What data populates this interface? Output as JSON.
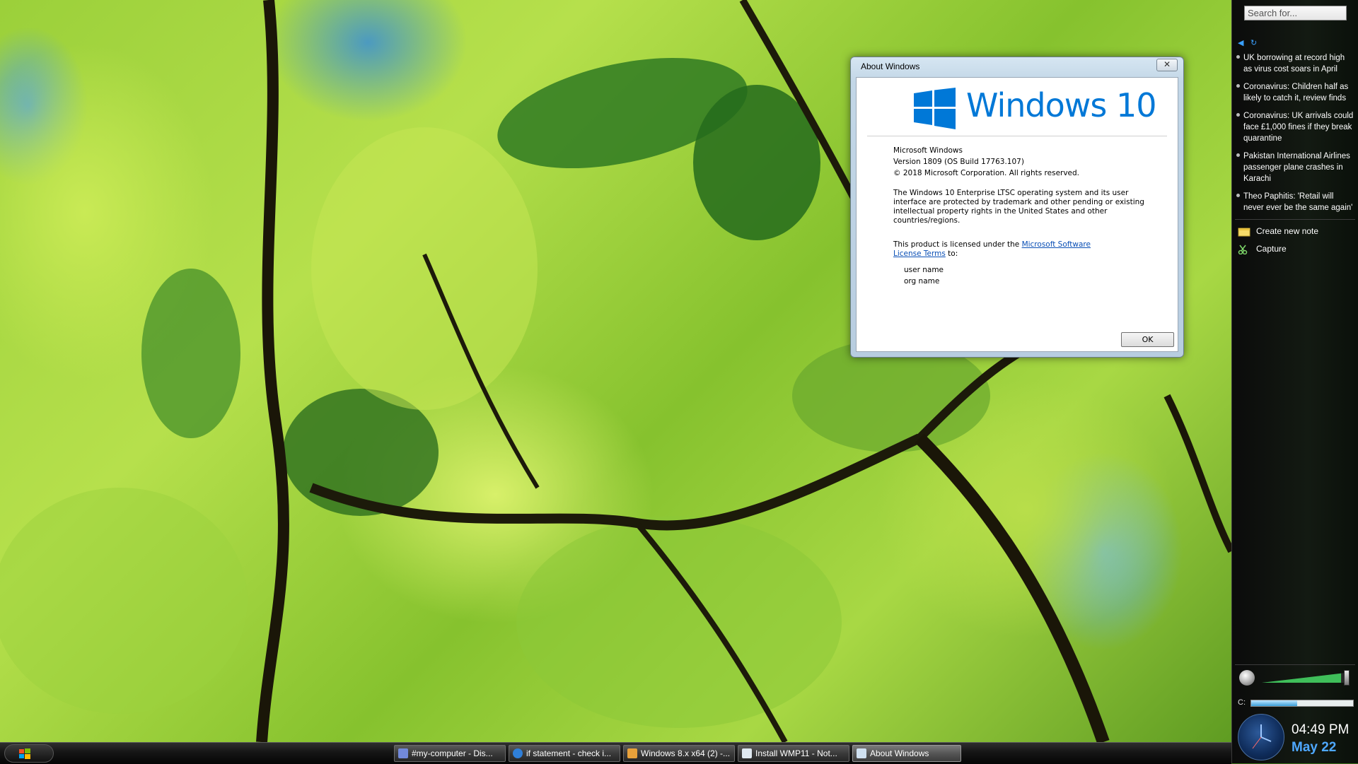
{
  "sidebar": {
    "search_placeholder": "Search for...",
    "news": [
      "UK borrowing at record high as virus cost soars in April",
      "Coronavirus: Children half as likely to catch it, review finds",
      "Coronavirus: UK arrivals could face £1,000 fines if they break quarantine",
      "Pakistan International Airlines passenger plane crashes in Karachi",
      "Theo Paphitis: 'Retail will never ever be the same again'"
    ],
    "actions": {
      "create_note": "Create new note",
      "capture": "Capture"
    },
    "drive_label": "C:",
    "drive_usage": 0.45,
    "volume_level": 0.95,
    "clock": {
      "time": "04:49 PM",
      "date": "May 22"
    }
  },
  "dialog": {
    "title": "About Windows",
    "close_glyph": "✕",
    "wordmark": "Windows 10",
    "product": "Microsoft Windows",
    "version": "Version 1809 (OS Build 17763.107)",
    "copyright": "© 2018 Microsoft Corporation. All rights reserved.",
    "description": "The Windows 10 Enterprise LTSC operating system and its user interface are protected by trademark and other pending or existing intellectual property rights in the United States and other countries/regions.",
    "license_prefix": "This product is licensed under the ",
    "license_link": "Microsoft Software License Terms",
    "license_suffix": " to:",
    "user_name": "user name",
    "org_name": "org name",
    "ok_label": "OK"
  },
  "taskbar": {
    "items": [
      {
        "label": "#my-computer - Dis...",
        "icon": "discord-icon",
        "color": "#7289da"
      },
      {
        "label": "if statement - check i...",
        "icon": "browser-icon",
        "color": "#2f7fd8"
      },
      {
        "label": "Windows 8.x x64 (2) -...",
        "icon": "virtualbox-icon",
        "color": "#e8a13a"
      },
      {
        "label": "Install WMP11 - Not...",
        "icon": "notepad-icon",
        "color": "#dfe8f0"
      },
      {
        "label": "About Windows",
        "icon": "window-icon",
        "color": "#cfe0f0"
      }
    ]
  },
  "colors": {
    "accent": "#0078d7",
    "link": "#0a4fb5",
    "clock_date": "#4ea8ff"
  }
}
